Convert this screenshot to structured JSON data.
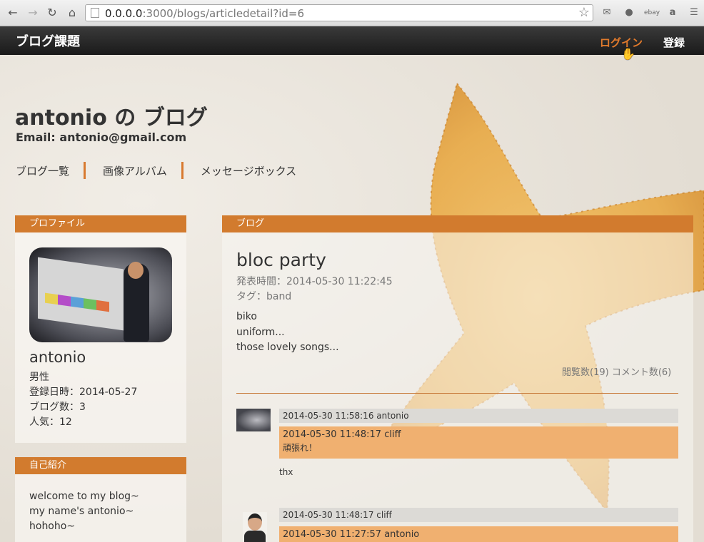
{
  "browser": {
    "url_host": "0.0.0.0",
    "url_rest": ":3000/blogs/articledetail?id=6",
    "ext_ebay": "ebay",
    "ext_amazon": "a"
  },
  "header": {
    "brand": "ブログ課題",
    "login": "ログイン",
    "register": "登録"
  },
  "blog": {
    "title": "antonio の ブログ",
    "email": "Email: antonio@gmail.com",
    "menu": [
      "ブログ一覧",
      "画像アルバム",
      "メッセージボックス"
    ]
  },
  "profile": {
    "heading": "プロファイル",
    "name": "antonio",
    "gender": "男性",
    "registered": "登録日時：2014-05-27",
    "blog_count": "ブログ数：3",
    "popularity": "人気：12"
  },
  "intro": {
    "heading": "自己紹介",
    "lines": [
      "welcome to my blog~",
      "my name's antonio~",
      "hohoho~"
    ]
  },
  "article": {
    "heading": "ブログ",
    "title": "bloc party",
    "published": "発表時間：2014-05-30 11:22:45",
    "tags": "タグ：band",
    "body": [
      "biko",
      "uniform...",
      "those lovely songs..."
    ],
    "stats": "閲覧数(19) コメント数(6)"
  },
  "comments": [
    {
      "header": "2014-05-30 11:58:16 antonio",
      "quote_header": "2014-05-30 11:48:17 cliff",
      "quote_text": "頑張れ！",
      "text": "thx"
    },
    {
      "header": "2014-05-30 11:48:17 cliff",
      "quote_header": "2014-05-30 11:27:57 antonio"
    }
  ],
  "colors": {
    "accent": "#d27b2e",
    "login": "#e07a2c",
    "quote_bg": "#f0b070"
  }
}
